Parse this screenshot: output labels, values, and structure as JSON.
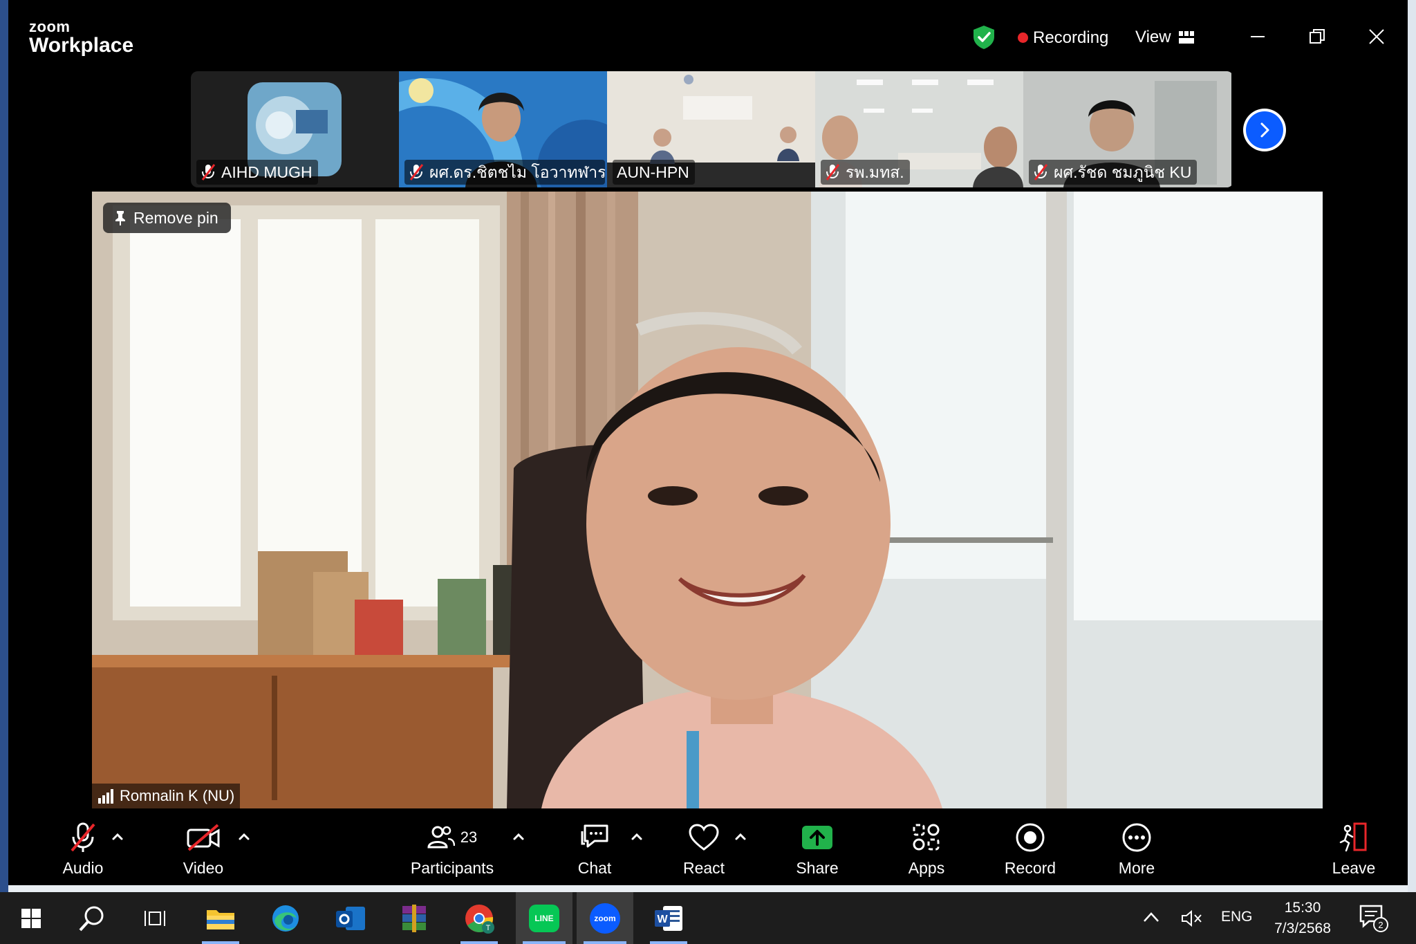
{
  "app": {
    "logo_small": "zoom",
    "logo_large": "Workplace"
  },
  "titlebar": {
    "recording_label": "Recording",
    "view_label": "View",
    "accent": "#0b5cff",
    "record_color": "#e8262a",
    "secure_color": "#21b24b"
  },
  "thumbnails": [
    {
      "name": "AIHD MUGH",
      "muted": true,
      "icon": "mic-muted-icon"
    },
    {
      "name": "ผศ.ดร.ชิตชไม  โอวาทฬาร...",
      "muted": true,
      "icon": "mic-muted-icon"
    },
    {
      "name": "AUN-HPN",
      "muted": false
    },
    {
      "name": "รพ.มทส.",
      "muted": true,
      "icon": "mic-muted-icon"
    },
    {
      "name": "ผศ.รัชด ชมภูนิช KU",
      "muted": true,
      "icon": "mic-muted-icon"
    }
  ],
  "main_video": {
    "pin_label": "Remove pin",
    "speaker_name": "Romnalin K (NU)"
  },
  "controls": {
    "audio": "Audio",
    "video": "Video",
    "participants": "Participants",
    "participants_count": "23",
    "chat": "Chat",
    "react": "React",
    "share": "Share",
    "apps": "Apps",
    "record": "Record",
    "more": "More",
    "leave": "Leave",
    "share_color": "#21b24b",
    "leave_color": "#e8262a"
  },
  "taskbar": {
    "apps": [
      "start-icon",
      "search-icon",
      "task-view-icon",
      "file-explorer-icon",
      "edge-icon",
      "outlook-icon",
      "winrar-icon",
      "chrome-icon",
      "line-icon",
      "zoom-icon",
      "word-icon"
    ],
    "zoom_label": "zoom",
    "line_label": "LINE",
    "language": "ENG",
    "time": "15:30",
    "date": "7/3/2568",
    "notification_count": "2"
  }
}
